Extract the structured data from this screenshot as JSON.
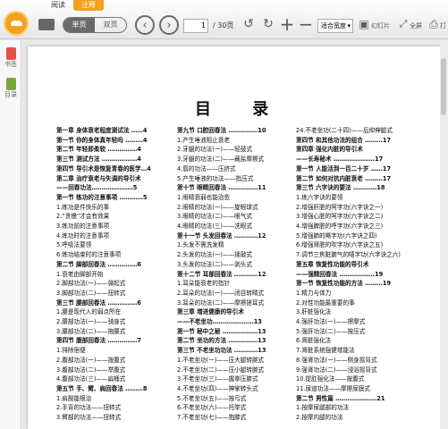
{
  "tabs": [
    "阅读",
    "注释"
  ],
  "toolbar": {
    "single": "单页",
    "double": "双页",
    "page_value": "1",
    "page_total": "/ 30页",
    "fit_mode": "适合宽度",
    "slideshow": "幻灯片",
    "fullscreen": "全屏",
    "print": "打"
  },
  "sidebar": {
    "bookmarks": "书签",
    "toc": "目录"
  },
  "document": {
    "title": "目 录",
    "col1": [
      "第一章 身体衰老程度测试法 ……4",
      "第一节 你的身体真年轻吗 ………4",
      "第二节 年轻即柔软 ……………4",
      "第三节 测试方法 ………………4",
      "第四节 导引术是恢复青春的医学…4",
      "第二章 治疗衰老与失调的导引术",
      "——回春功法…………………5",
      "第一节 练功的注意事项 …………5",
      "1.练功是件快乐的事",
      "2.“贪慢”才会有效果",
      "3.练功前的注意事项",
      "4.练功时的注意事项",
      "5.呼吸法要领",
      "6.练功结束时的注意事项",
      "第二节 脚部回春法 ……………6",
      "1.衰老由脚部开始",
      "2.脚部功法(一)——弹起式",
      "3.脚部功法(二)——扭转式",
      "第三节 腰部回春法 ……………6",
      "1.腰是现代人的弱点所在",
      "2.腰部功法(一)——骑身式",
      "3.腰部功法(二)——拖腰式",
      "第四节 腹部回春法 ……………7",
      "1.排除宿便",
      "2.腹部功法(一)——按腹式",
      "3.腹部功法(二)——举腹式",
      "4.腹部功法(三)——扁桶式",
      "第五节 手、臂、肩回春法 ………8",
      "1.肩酸能根治",
      "2.手背的功法——扭转式",
      "3.臂部的功法——扭转式"
    ],
    "col2": [
      "第九节 口腔回春法 ……………10",
      "1.产生唾液阻止衰老",
      "2.牙龈的功法(一)——轻鼓式",
      "3.牙龈的功法(二)——藏盐摩擦式",
      "4.唇的功法——压挤式",
      "5.产生唾液的功法——指压式",
      "第十节 眼睛回春法 ……………11",
      "1.眼睛衰弱也能治愈",
      "2.眼睛的功法(一)——旋眼球式",
      "3.眼睛的功法(二)——眼气式",
      "4.眼睛的功法(三)——洗眼式",
      "第十一节 头发回春法 …………12",
      "1.头发不需洗发精",
      "2.头发的功法(一)——揉敲式",
      "3.头发的功法(二)——剥头式",
      "第十二节 耳部回春法 …………12",
      "1.耳朵能衰老的指针",
      "2.耳朵的功法(一)——闭目转睛式",
      "3.耳朵的功法(二)——摩擦搓耳式",
      "第三章 增进健康的导引术",
      "——不老坐功…………………13",
      "第一节 秘中之秘 ………………13",
      "第二节 坐功的方法 ……………13",
      "第三节 不老坐功功法 …………13",
      "1.不老坐功(一)——压大腿转腕式",
      "2.不老坐功(二)——压小腿转腕式",
      "3.不老坐功(三)——握拳压膝式",
      "4.不老坐功(四)——抻掌转头式",
      "5.不老坐功(五)——按弓式",
      "6.不老坐功(六)——托举式",
      "7.不老坐功(七)——抱膝式"
    ],
    "col3": [
      "24.不老坐功(二十四)——后抑伸腿式",
      "第四节 和其他功法的组合 ………17",
      "第四章 强化内脏的导引术",
      "——长寿秘术 …………………17",
      "第一节 人能活到一百二十岁 ……17",
      "第二节 如何对抗内脏衰老 ………17",
      "第三节 六字诀的要法 …………18",
      "1.练六字诀的要领",
      "2.增强肝脏的呵字功(六字诀之一)",
      "3.增强心脏的呵字功(六字诀之二)",
      "4.增强脾脏的呼字功(六字诀之三)",
      "5.增强肺的嘶字功(六字诀之四)",
      "6.增强肾脏的吹字功(六字诀之五)",
      "7.调节三焦脏腑气的嘻字功(六字诀之六)",
      "第五章 恢复性功能的导引术",
      "——强精回春法 ………………19",
      "第一节 恢复性功能的方法 ………19",
      "1.精力与体力",
      "2.对性功能最重要的事",
      "3.肝脏强化法",
      "4.强肝功法(一)——擦摩式",
      "5.强肝功法(二)——按压式",
      "6.肾脏强化法",
      "7.肾脏系统强健增能法",
      "8.强肾功法(一)——侧身摇背式",
      "9.强肾功法(二)——浸浴摇背式",
      "10.提肛强化法——按腹式",
      "11.尿道功法——摩擦尿膜式",
      "第二节 男性篇 …………………21",
      "1.按摩尿腿部的功法",
      "2.按摩内腿的功法"
    ]
  }
}
